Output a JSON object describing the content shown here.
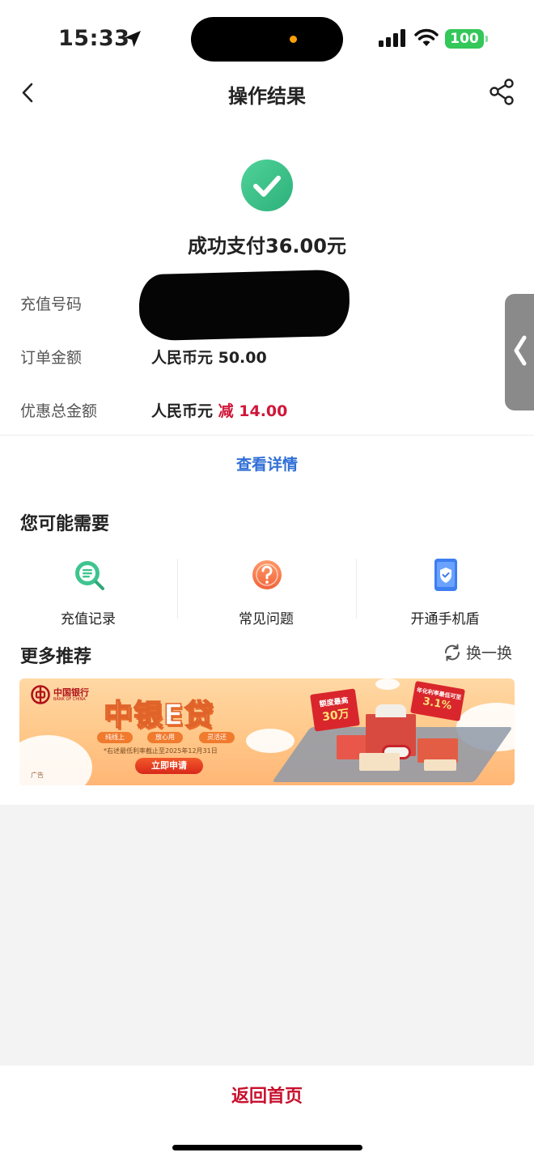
{
  "status_bar": {
    "time": "15:33",
    "battery": "100"
  },
  "nav": {
    "title": "操作结果"
  },
  "result": {
    "success_text": "成功支付36.00元",
    "rows": [
      {
        "label": "充值号码",
        "value": ""
      },
      {
        "label": "订单金额",
        "value": "人民币元 50.00"
      },
      {
        "label": "优惠总金额",
        "value_prefix": "人民币元 ",
        "discount_label": "减",
        "discount_amount": "14.00"
      }
    ],
    "details_link": "查看详情"
  },
  "you_may_need": {
    "title": "您可能需要",
    "items": [
      {
        "label": "充值记录",
        "icon": "search-record-icon"
      },
      {
        "label": "常见问题",
        "icon": "question-icon"
      },
      {
        "label": "开通手机盾",
        "icon": "phone-shield-icon"
      }
    ]
  },
  "recommend": {
    "title": "更多推荐",
    "swap_label": "换一换",
    "banner": {
      "bank_name_cn": "中国银行",
      "bank_name_en": "BANK OF CHINA",
      "title": "中银E贷",
      "pills": [
        "纯线上",
        "放心用",
        "灵活还"
      ],
      "note": "*右述最低利率截止至2025年12月31日",
      "apply_label": "立即申请",
      "ad_tag": "广告",
      "board_left_line1": "额度最高",
      "board_left_line2": "30万",
      "board_right_line1": "年化利率最低可至",
      "board_right_line2": "3.1%"
    }
  },
  "bottom": {
    "home_label": "返回首页"
  },
  "colors": {
    "accent_red": "#c8102e",
    "link_blue": "#2f6fd6",
    "success_green": "#3dbf86"
  }
}
